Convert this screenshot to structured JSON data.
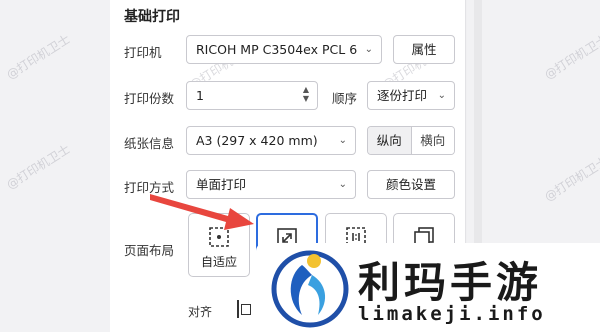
{
  "watermark": "@打印机卫士",
  "section_title": "基础打印",
  "printer": {
    "label": "打印机",
    "value": "RICOH MP C3504ex PCL 6",
    "props_button": "属性"
  },
  "copies": {
    "label": "打印份数",
    "value": "1",
    "order_label": "顺序",
    "order_value": "逐份打印"
  },
  "paper": {
    "label": "纸张信息",
    "value": "A3 (297 x 420 mm)",
    "portrait": "纵向",
    "landscape": "横向"
  },
  "print_mode": {
    "label": "打印方式",
    "value": "单面打印",
    "color_button": "颜色设置"
  },
  "page_layout": {
    "label": "页面布局",
    "tiles": [
      {
        "label": "自适应"
      },
      {
        "label": ""
      },
      {
        "label": ""
      },
      {
        "label": ""
      }
    ]
  },
  "align": {
    "label": "对齐"
  },
  "logo": {
    "name": "利玛手游",
    "url": "limakeji.info"
  },
  "colors": {
    "accent": "#2d6cdf",
    "arrow": "#e8463e"
  }
}
